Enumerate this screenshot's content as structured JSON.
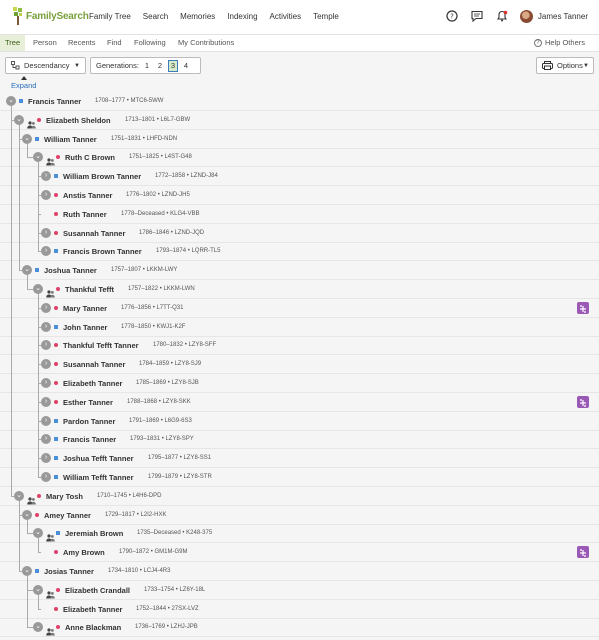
{
  "header": {
    "logo": "FamilySearch",
    "nav": [
      "Family Tree",
      "Search",
      "Memories",
      "Indexing",
      "Activities",
      "Temple"
    ],
    "user": "James Tanner",
    "colors": {
      "brand": "#7aa03c",
      "male": "#4a90d9",
      "female": "#e0406a",
      "tasks": "#9b59b6"
    }
  },
  "subnav": {
    "tabs": [
      "Tree",
      "Person",
      "Recents",
      "Find",
      "Following",
      "My Contributions"
    ],
    "help": "Help Others"
  },
  "toolbar": {
    "view": "Descendancy",
    "gen_label": "Generations:",
    "gens": [
      "1",
      "2",
      "3",
      "4"
    ],
    "gen_selected": "3",
    "options": "Options",
    "expand": "Expand"
  },
  "tree": [
    {
      "name": "Francis Tanner",
      "details": "1708–1777 • MTC6-5WW",
      "g": "m",
      "lvl": 0,
      "spouse": false,
      "tasks": false
    },
    {
      "name": "Elizabeth Sheldon",
      "details": "1713–1801 • L6L7-GBW",
      "g": "f",
      "lvl": 1,
      "spouse": true,
      "tasks": false
    },
    {
      "name": "William Tanner",
      "details": "1751–1831 • LHFD-NDN",
      "g": "m",
      "lvl": 2,
      "spouse": false,
      "tasks": false
    },
    {
      "name": "Ruth C Brown",
      "details": "1751–1825 • L4ST-G48",
      "g": "f",
      "lvl": 3,
      "spouse": true,
      "tasks": false
    },
    {
      "name": "William Brown Tanner",
      "details": "1772–1858 • LZND-J84",
      "g": "m",
      "lvl": 4,
      "spouse": false,
      "tasks": false
    },
    {
      "name": "Anstis Tanner",
      "details": "1776–1802 • LZND-JH5",
      "g": "f",
      "lvl": 4,
      "spouse": false,
      "tasks": false
    },
    {
      "name": "Ruth Tanner",
      "details": "1778–Deceased • KLG4-VBB",
      "g": "f",
      "lvl": 4,
      "spouse": false,
      "tasks": false,
      "nobtn": true
    },
    {
      "name": "Susannah Tanner",
      "details": "1786–1846 • LZND-JQD",
      "g": "f",
      "lvl": 4,
      "spouse": false,
      "tasks": false
    },
    {
      "name": "Francis Brown Tanner",
      "details": "1793–1874 • LQRR-TL5",
      "g": "m",
      "lvl": 4,
      "spouse": false,
      "tasks": false
    },
    {
      "name": "Joshua Tanner",
      "details": "1757–1807 • LKKM-LWY",
      "g": "m",
      "lvl": 2,
      "spouse": false,
      "tasks": false
    },
    {
      "name": "Thankful Tefft",
      "details": "1757–1822 • LKKM-LWN",
      "g": "f",
      "lvl": 3,
      "spouse": true,
      "tasks": false
    },
    {
      "name": "Mary Tanner",
      "details": "1776–1856 • L7TT-Q31",
      "g": "f",
      "lvl": 4,
      "spouse": false,
      "tasks": true
    },
    {
      "name": "John Tanner",
      "details": "1778–1850 • KWJ1-K2F",
      "g": "m",
      "lvl": 4,
      "spouse": false,
      "tasks": false
    },
    {
      "name": "Thankful Tefft Tanner",
      "details": "1780–1832 • LZY8-SFF",
      "g": "f",
      "lvl": 4,
      "spouse": false,
      "tasks": false
    },
    {
      "name": "Susannah Tanner",
      "details": "1784–1859 • LZY8-SJ9",
      "g": "f",
      "lvl": 4,
      "spouse": false,
      "tasks": false
    },
    {
      "name": "Elizabeth Tanner",
      "details": "1785–1869 • LZY8-SJB",
      "g": "f",
      "lvl": 4,
      "spouse": false,
      "tasks": false
    },
    {
      "name": "Esther Tanner",
      "details": "1788–1868 • LZY8-SKK",
      "g": "f",
      "lvl": 4,
      "spouse": false,
      "tasks": true
    },
    {
      "name": "Pardon Tanner",
      "details": "1791–1869 • L6G9-6S3",
      "g": "m",
      "lvl": 4,
      "spouse": false,
      "tasks": false
    },
    {
      "name": "Francis Tanner",
      "details": "1793–1831 • LZY8-SPY",
      "g": "m",
      "lvl": 4,
      "spouse": false,
      "tasks": false
    },
    {
      "name": "Joshua Tefft Tanner",
      "details": "1795–1877 • LZY8-SS1",
      "g": "m",
      "lvl": 4,
      "spouse": false,
      "tasks": false
    },
    {
      "name": "William Tefft Tanner",
      "details": "1799–1879 • LZY8-STR",
      "g": "m",
      "lvl": 4,
      "spouse": false,
      "tasks": false
    },
    {
      "name": "Mary Tosh",
      "details": "1710–1745 • L4H6-DPD",
      "g": "f",
      "lvl": 1,
      "spouse": true,
      "tasks": false
    },
    {
      "name": "Amey Tanner",
      "details": "1729–1817 • L2I2-HXK",
      "g": "f",
      "lvl": 2,
      "spouse": false,
      "tasks": false
    },
    {
      "name": "Jeremiah Brown",
      "details": "1735–Deceased • K248-375",
      "g": "m",
      "lvl": 3,
      "spouse": true,
      "tasks": false
    },
    {
      "name": "Amy Brown",
      "details": "1790–1872 • GM1M-G9M",
      "g": "f",
      "lvl": 4,
      "spouse": false,
      "tasks": true,
      "nobtn": true
    },
    {
      "name": "Josias Tanner",
      "details": "1734–1810 • LCJ4-4R3",
      "g": "m",
      "lvl": 2,
      "spouse": false,
      "tasks": false
    },
    {
      "name": "Elizabeth Crandall",
      "details": "1733–1754 • LZ6Y-18L",
      "g": "f",
      "lvl": 3,
      "spouse": true,
      "tasks": false
    },
    {
      "name": "Elizabeth Tanner",
      "details": "1752–1844 • 27SX-LVZ",
      "g": "f",
      "lvl": 4,
      "spouse": false,
      "tasks": false,
      "nobtn": true
    },
    {
      "name": "Anne Blackman",
      "details": "1736–1769 • LZHJ-JPB",
      "g": "f",
      "lvl": 3,
      "spouse": true,
      "tasks": false
    }
  ]
}
